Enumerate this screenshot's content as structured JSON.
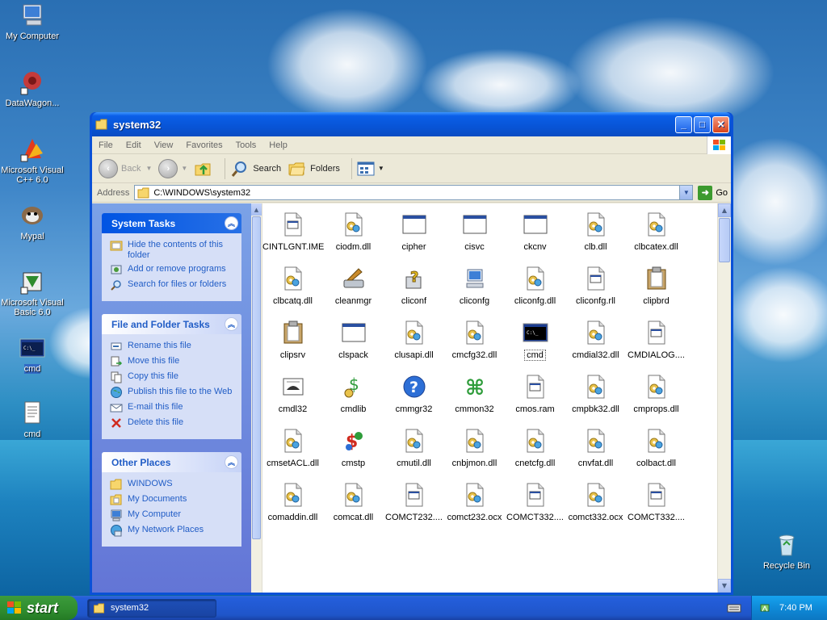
{
  "desktop": {
    "icons": [
      {
        "label": "My Computer"
      },
      {
        "label": "DataWagon..."
      },
      {
        "label": "Microsoft Visual C++ 6.0"
      },
      {
        "label": "Mypal"
      },
      {
        "label": "Microsoft Visual Basic 6.0"
      },
      {
        "label": "cmd"
      },
      {
        "label": "cmd"
      },
      {
        "label": "Recycle Bin"
      }
    ]
  },
  "window": {
    "title": "system32",
    "menu": [
      "File",
      "Edit",
      "View",
      "Favorites",
      "Tools",
      "Help"
    ],
    "toolbar": {
      "back": "Back",
      "search": "Search",
      "folders": "Folders"
    },
    "address": {
      "label": "Address",
      "value": "C:\\WINDOWS\\system32",
      "go": "Go"
    },
    "taskpane": {
      "system_tasks": {
        "title": "System Tasks",
        "items": [
          "Hide the contents of this folder",
          "Add or remove programs",
          "Search for files or folders"
        ]
      },
      "file_folder_tasks": {
        "title": "File and Folder Tasks",
        "items": [
          "Rename this file",
          "Move this file",
          "Copy this file",
          "Publish this file to the Web",
          "E-mail this file",
          "Delete this file"
        ]
      },
      "other_places": {
        "title": "Other Places",
        "items": [
          "WINDOWS",
          "My Documents",
          "My Computer",
          "My Network Places"
        ]
      }
    },
    "files": [
      "CINTLGNT.IME",
      "ciodm.dll",
      "cipher",
      "cisvc",
      "ckcnv",
      "clb.dll",
      "clbcatex.dll",
      "clbcatq.dll",
      "cleanmgr",
      "cliconf",
      "cliconfg",
      "cliconfg.dll",
      "cliconfg.rll",
      "clipbrd",
      "clipsrv",
      "clspack",
      "clusapi.dll",
      "cmcfg32.dll",
      "cmd",
      "cmdial32.dll",
      "CMDIALOG....",
      "cmdl32",
      "cmdlib",
      "cmmgr32",
      "cmmon32",
      "cmos.ram",
      "cmpbk32.dll",
      "cmprops.dll",
      "cmsetACL.dll",
      "cmstp",
      "cmutil.dll",
      "cnbjmon.dll",
      "cnetcfg.dll",
      "cnvfat.dll",
      "colbact.dll",
      "comaddin.dll",
      "comcat.dll",
      "COMCT232....",
      "comct232.ocx",
      "COMCT332....",
      "comct332.ocx",
      "COMCT332...."
    ]
  },
  "taskbar": {
    "start": "start",
    "task": "system32",
    "clock": "7:40 PM"
  }
}
